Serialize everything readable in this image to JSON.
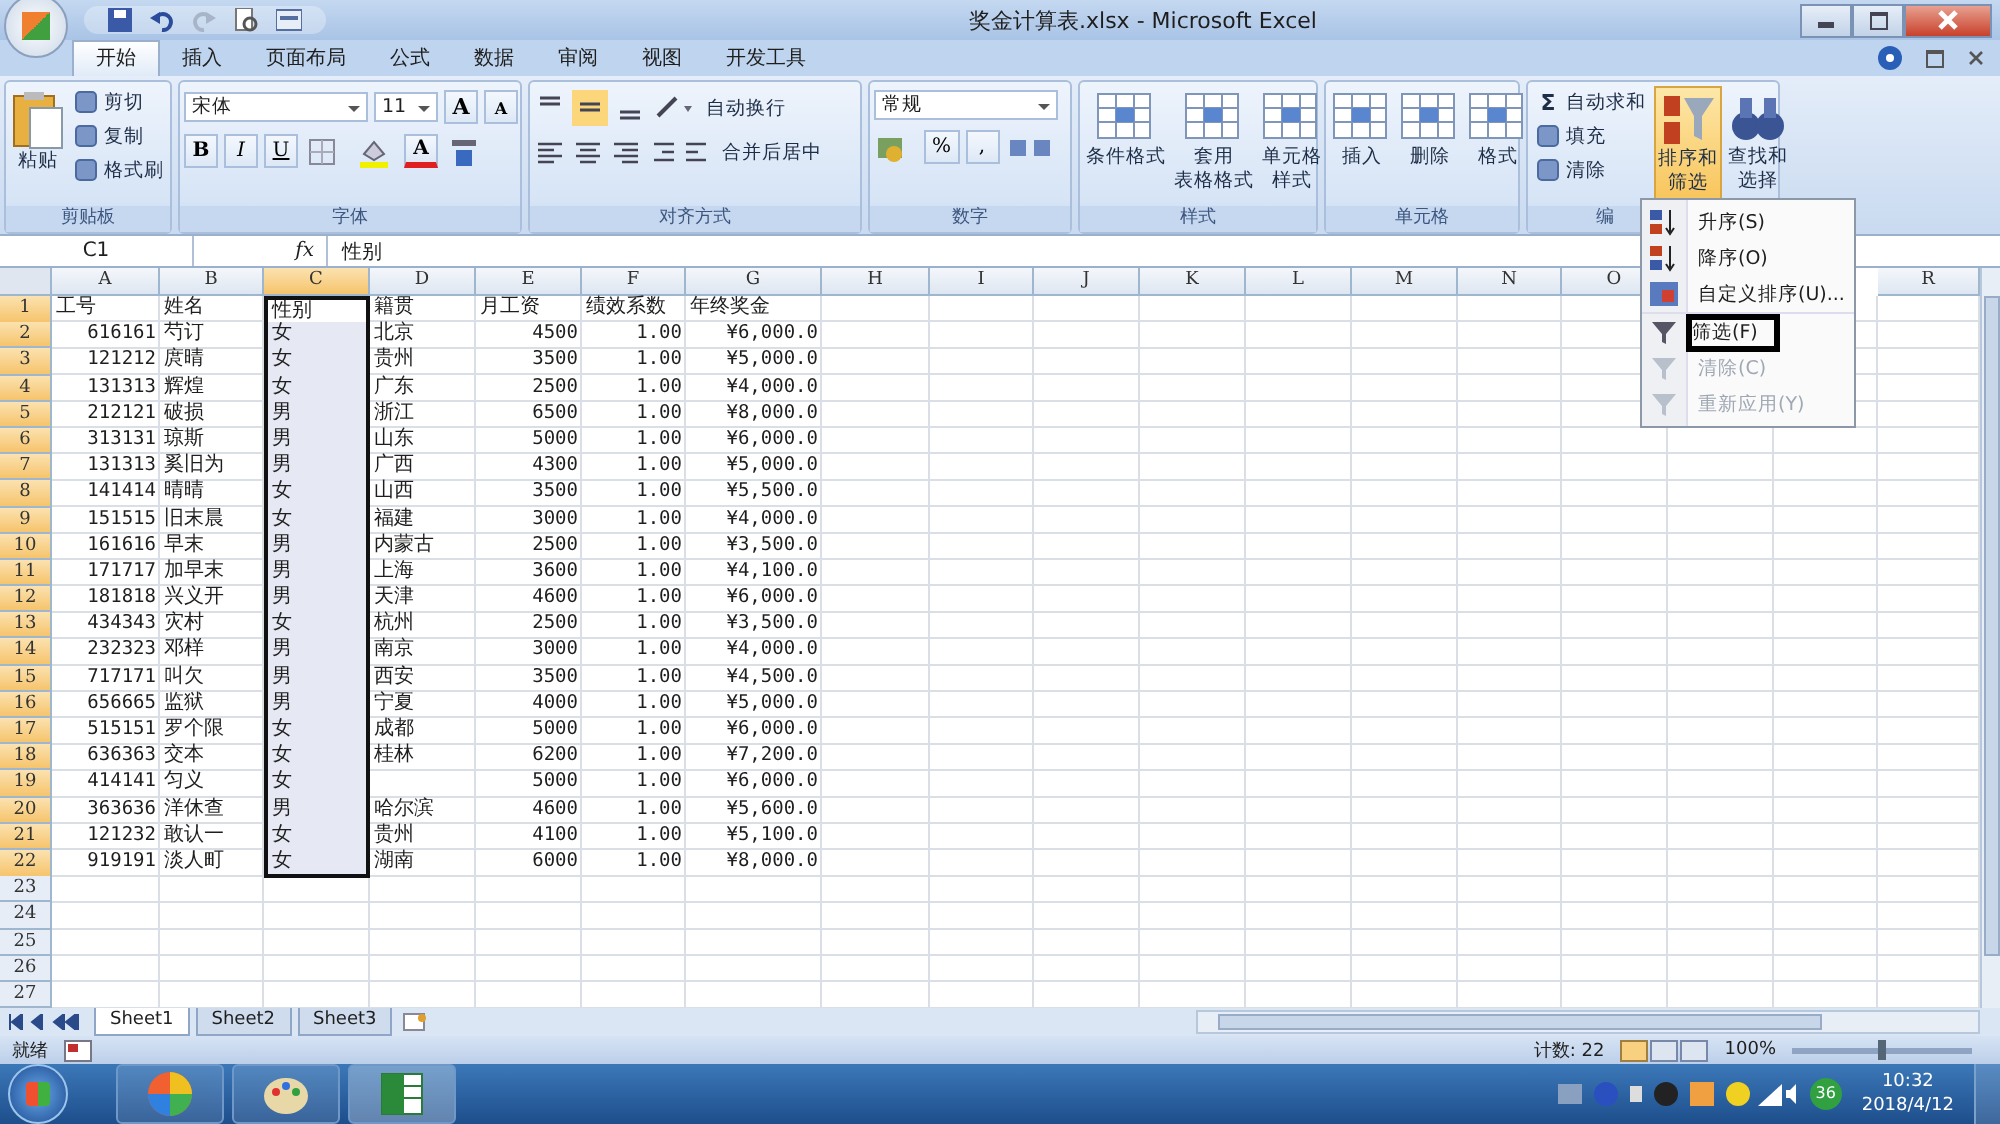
{
  "window": {
    "title": "奖金计算表.xlsx - Microsoft Excel"
  },
  "tabs": [
    {
      "label": "开始",
      "selected": true
    },
    {
      "label": "插入",
      "selected": false
    },
    {
      "label": "页面布局",
      "selected": false
    },
    {
      "label": "公式",
      "selected": false
    },
    {
      "label": "数据",
      "selected": false
    },
    {
      "label": "审阅",
      "selected": false
    },
    {
      "label": "视图",
      "selected": false
    },
    {
      "label": "开发工具",
      "selected": false
    }
  ],
  "ribbon": {
    "groups": [
      {
        "kind": "clipboard",
        "label": "剪贴板",
        "big": "粘贴",
        "items": [
          "剪切",
          "复制",
          "格式刷"
        ]
      },
      {
        "kind": "font",
        "label": "字体",
        "font": "宋体",
        "size": "11",
        "grow": "A",
        "shrink": "A",
        "bold": "B",
        "italic": "I",
        "underline": "U",
        "color_letter": "A"
      },
      {
        "kind": "align",
        "label": "对齐方式",
        "wrap": "自动换行",
        "merge": "合并后居中"
      },
      {
        "kind": "number",
        "label": "数字",
        "format": "常规",
        "percent": "%",
        "comma": ","
      },
      {
        "kind": "big",
        "label": "样式",
        "items": [
          [
            "条件格式"
          ],
          [
            "套用",
            "表格格式"
          ],
          [
            "单元格",
            "样式"
          ]
        ]
      },
      {
        "kind": "big",
        "label": "单元格",
        "items": [
          [
            "插入"
          ],
          [
            "删除"
          ],
          [
            "格式"
          ]
        ]
      },
      {
        "kind": "edit",
        "label": "编",
        "sigma": "Σ",
        "items": [
          "自动求和",
          "填充",
          "清除"
        ],
        "big": [
          {
            "lines": [
              "排序和",
              "筛选"
            ],
            "selected": true
          },
          {
            "lines": [
              "查找和",
              "选择"
            ],
            "selected": false
          }
        ]
      }
    ]
  },
  "formula_bar": {
    "name_box": "C1",
    "fx": "fx",
    "value": "性别"
  },
  "sheet": {
    "columns": [
      {
        "label": "A",
        "selected": false
      },
      {
        "label": "B",
        "selected": false
      },
      {
        "label": "C",
        "selected": true
      },
      {
        "label": "D",
        "selected": false
      },
      {
        "label": "E",
        "selected": false
      },
      {
        "label": "F",
        "selected": false
      },
      {
        "label": "G",
        "selected": false
      },
      {
        "label": "H",
        "selected": false
      },
      {
        "label": "I",
        "selected": false
      },
      {
        "label": "J",
        "selected": false
      },
      {
        "label": "K",
        "selected": false
      },
      {
        "label": "L",
        "selected": false
      },
      {
        "label": "M",
        "selected": false
      },
      {
        "label": "N",
        "selected": false
      },
      {
        "label": "O",
        "selected": false
      },
      {},
      {},
      {
        "label": "R",
        "selected": false
      }
    ],
    "rows": [
      {
        "num": "1",
        "kind": "header",
        "selected": true,
        "cells": [
          "工号",
          "姓名",
          "性别",
          "籍贯",
          "月工资",
          "绩效系数",
          "年终奖金"
        ]
      },
      {
        "num": "2",
        "kind": "data",
        "selected": true,
        "cells": [
          "616161",
          "芍订",
          "女",
          "北京",
          "4500",
          "1.00",
          "¥6,000.0"
        ]
      },
      {
        "num": "3",
        "kind": "data",
        "selected": true,
        "cells": [
          "121212",
          "庹晴",
          "女",
          "贵州",
          "3500",
          "1.00",
          "¥5,000.0"
        ]
      },
      {
        "num": "4",
        "kind": "data",
        "selected": true,
        "cells": [
          "131313",
          "辉煌",
          "女",
          "广东",
          "2500",
          "1.00",
          "¥4,000.0"
        ]
      },
      {
        "num": "5",
        "kind": "data",
        "selected": true,
        "cells": [
          "212121",
          "破损",
          "男",
          "浙江",
          "6500",
          "1.00",
          "¥8,000.0"
        ]
      },
      {
        "num": "6",
        "kind": "data",
        "selected": true,
        "cells": [
          "313131",
          "琼斯",
          "男",
          "山东",
          "5000",
          "1.00",
          "¥6,000.0"
        ]
      },
      {
        "num": "7",
        "kind": "data",
        "selected": true,
        "cells": [
          "131313",
          "奚旧为",
          "男",
          "广西",
          "4300",
          "1.00",
          "¥5,000.0"
        ]
      },
      {
        "num": "8",
        "kind": "data",
        "selected": true,
        "cells": [
          "141414",
          "晴晴",
          "女",
          "山西",
          "3500",
          "1.00",
          "¥5,500.0"
        ]
      },
      {
        "num": "9",
        "kind": "data",
        "selected": true,
        "cells": [
          "151515",
          "旧末晨",
          "女",
          "福建",
          "3000",
          "1.00",
          "¥4,000.0"
        ]
      },
      {
        "num": "10",
        "kind": "data",
        "selected": true,
        "cells": [
          "161616",
          "早末",
          "男",
          "内蒙古",
          "2500",
          "1.00",
          "¥3,500.0"
        ]
      },
      {
        "num": "11",
        "kind": "data",
        "selected": true,
        "cells": [
          "171717",
          "加早末",
          "男",
          "上海",
          "3600",
          "1.00",
          "¥4,100.0"
        ]
      },
      {
        "num": "12",
        "kind": "data",
        "selected": true,
        "cells": [
          "181818",
          "兴义开",
          "男",
          "天津",
          "4600",
          "1.00",
          "¥6,000.0"
        ]
      },
      {
        "num": "13",
        "kind": "data",
        "selected": true,
        "cells": [
          "434343",
          "灾村",
          "女",
          "杭州",
          "2500",
          "1.00",
          "¥3,500.0"
        ]
      },
      {
        "num": "14",
        "kind": "data",
        "selected": true,
        "cells": [
          "232323",
          "邓样",
          "男",
          "南京",
          "3000",
          "1.00",
          "¥4,000.0"
        ]
      },
      {
        "num": "15",
        "kind": "data",
        "selected": true,
        "cells": [
          "717171",
          "叫欠",
          "男",
          "西安",
          "3500",
          "1.00",
          "¥4,500.0"
        ]
      },
      {
        "num": "16",
        "kind": "data",
        "selected": true,
        "cells": [
          "656665",
          "监狱",
          "男",
          "宁夏",
          "4000",
          "1.00",
          "¥5,000.0"
        ]
      },
      {
        "num": "17",
        "kind": "data",
        "selected": true,
        "cells": [
          "515151",
          "罗个限",
          "女",
          "成都",
          "5000",
          "1.00",
          "¥6,000.0"
        ]
      },
      {
        "num": "18",
        "kind": "data",
        "selected": true,
        "cells": [
          "636363",
          "交本",
          "女",
          "桂林",
          "6200",
          "1.00",
          "¥7,200.0"
        ]
      },
      {
        "num": "19",
        "kind": "data",
        "selected": true,
        "cells": [
          "414141",
          "匀义",
          "女",
          null,
          "5000",
          "1.00",
          "¥6,000.0"
        ]
      },
      {
        "num": "20",
        "kind": "data",
        "selected": true,
        "cells": [
          "363636",
          "洋休查",
          "男",
          "哈尔滨",
          "4600",
          "1.00",
          "¥5,600.0"
        ]
      },
      {
        "num": "21",
        "kind": "data",
        "selected": true,
        "cells": [
          "121232",
          "敢认一",
          "女",
          "贵州",
          "4100",
          "1.00",
          "¥5,100.0"
        ]
      },
      {
        "num": "22",
        "kind": "data",
        "selected": true,
        "cells": [
          "919191",
          "淡人町",
          "女",
          "湖南",
          "6000",
          "1.00",
          "¥8,000.0"
        ]
      },
      {
        "num": "23",
        "kind": "data",
        "selected": false,
        "cells": []
      },
      {
        "num": "24",
        "kind": "data",
        "selected": false,
        "cells": []
      },
      {
        "num": "25",
        "kind": "data",
        "selected": false,
        "cells": []
      },
      {
        "num": "26",
        "kind": "data",
        "selected": false,
        "cells": []
      },
      {
        "num": "27",
        "kind": "data",
        "selected": false,
        "cells": []
      }
    ]
  },
  "menu": {
    "items": [
      {
        "label": "升序(S)",
        "kind": "asc",
        "disabled": false,
        "highlighted": false
      },
      {
        "label": "降序(O)",
        "kind": "desc",
        "disabled": false,
        "highlighted": false
      },
      {
        "label": "自定义排序(U)...",
        "kind": "custom",
        "disabled": false,
        "highlighted": false
      },
      {
        "label": "筛选(F)",
        "kind": "filter",
        "disabled": false,
        "highlighted": true
      },
      {
        "label": "清除(C)",
        "kind": "clear",
        "disabled": true,
        "highlighted": false
      },
      {
        "label": "重新应用(Y)",
        "kind": "reapply",
        "disabled": true,
        "highlighted": false
      }
    ]
  },
  "sheet_tabs": [
    {
      "label": "Sheet1",
      "selected": true
    },
    {
      "label": "Sheet2",
      "selected": false
    },
    {
      "label": "Sheet3",
      "selected": false
    }
  ],
  "status_bar": {
    "status": "就绪",
    "count": "计数: 22",
    "zoom": "100%",
    "zoom_slider": {
      "level": 0.5
    }
  },
  "taskbar": {
    "badge": "36",
    "time": "10:32",
    "date": "2018/4/12"
  }
}
